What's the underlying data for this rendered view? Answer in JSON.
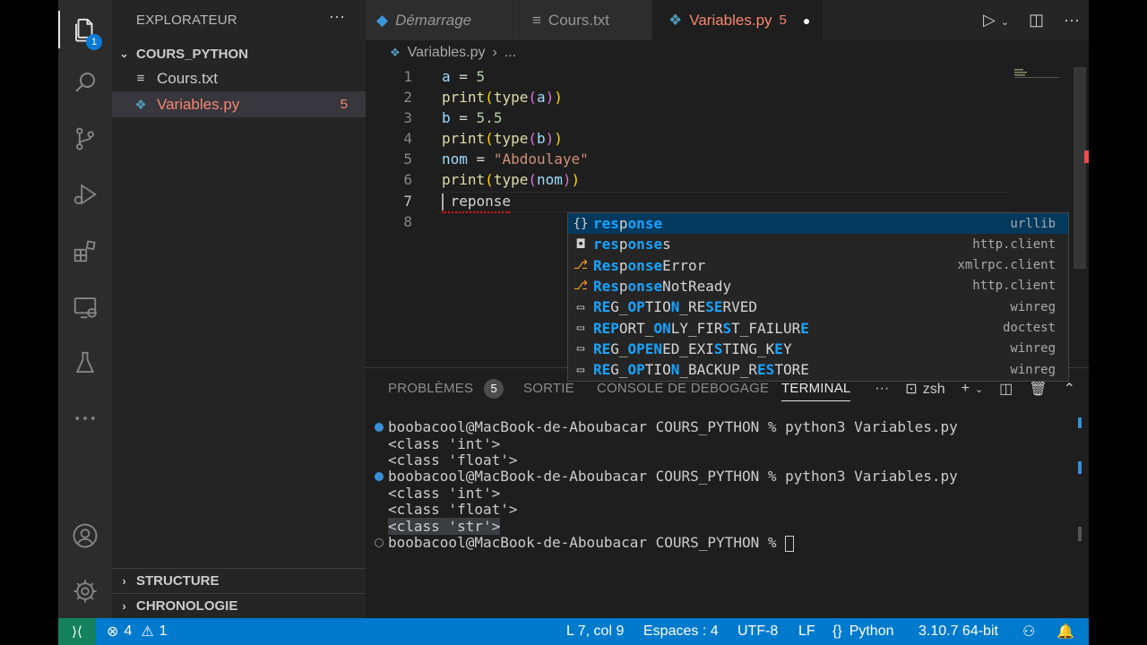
{
  "activity_bar": {
    "explorer_badge": "1"
  },
  "sidebar": {
    "title": "EXPLORATEUR",
    "more": "···",
    "folder": "COURS_PYTHON",
    "files": [
      {
        "name": "Cours.txt",
        "count": ""
      },
      {
        "name": "Variables.py",
        "count": "5"
      }
    ],
    "bottom_sections": [
      "STRUCTURE",
      "CHRONOLOGIE"
    ]
  },
  "tabs": [
    {
      "label": "Démarrage"
    },
    {
      "label": "Cours.txt"
    },
    {
      "label": "Variables.py",
      "count": "5"
    }
  ],
  "breadcrumb": {
    "file": "Variables.py",
    "rest": "..."
  },
  "editor": {
    "line_numbers": [
      "1",
      "2",
      "3",
      "4",
      "5",
      "6",
      "7",
      "8"
    ],
    "lines": {
      "l1": {
        "a": "a",
        "eq": " = ",
        "n": "5"
      },
      "l2": {
        "fn": "print",
        "o": "(",
        "t": "type",
        "o2": "(",
        "v": "a",
        "c2": ")",
        "c": ")"
      },
      "l3": {
        "a": "b",
        "eq": " = ",
        "n": "5.5"
      },
      "l4": {
        "fn": "print",
        "o": "(",
        "t": "type",
        "o2": "(",
        "v": "b",
        "c2": ")",
        "c": ")"
      },
      "l5": {
        "a": "nom",
        "eq": " = ",
        "s": "\"Abdoulaye\""
      },
      "l6": {
        "fn": "print",
        "o": "(",
        "t": "type",
        "o2": "(",
        "v": "nom",
        "c2": ")",
        "c": ")"
      },
      "l7": {
        "text": " reponse"
      }
    }
  },
  "suggestions": [
    {
      "icon": "{}",
      "parts": [
        [
          "hl",
          "res"
        ],
        [
          "",
          "p"
        ],
        [
          "hl",
          "onse"
        ]
      ],
      "detail": "urllib"
    },
    {
      "icon": "◘",
      "parts": [
        [
          "hl",
          "res"
        ],
        [
          "",
          "p"
        ],
        [
          "hl",
          "onse"
        ],
        [
          "",
          "s"
        ]
      ],
      "detail": "http.client"
    },
    {
      "icon": "⎇",
      "parts": [
        [
          "hl",
          "Res"
        ],
        [
          "",
          "p"
        ],
        [
          "hl",
          "onse"
        ],
        [
          "",
          "Error"
        ]
      ],
      "detail": "xmlrpc.client"
    },
    {
      "icon": "⎇",
      "parts": [
        [
          "hl",
          "Res"
        ],
        [
          "",
          "p"
        ],
        [
          "hl",
          "onse"
        ],
        [
          "",
          "NotReady"
        ]
      ],
      "detail": "http.client"
    },
    {
      "icon": "▭",
      "parts": [
        [
          "hl",
          "RE"
        ],
        [
          "",
          "G_"
        ],
        [
          "hl",
          "OP"
        ],
        [
          "",
          "TIO"
        ],
        [
          "hl",
          "N"
        ],
        [
          "",
          "_RE"
        ],
        [
          "hl",
          "SE"
        ],
        [
          "",
          "RVED"
        ]
      ],
      "detail": "winreg"
    },
    {
      "icon": "▭",
      "parts": [
        [
          "hl",
          "REP"
        ],
        [
          "",
          "ORT_"
        ],
        [
          "hl",
          "ON"
        ],
        [
          "",
          "LY_FIR"
        ],
        [
          "hl",
          "S"
        ],
        [
          "",
          "T_FAILUR"
        ],
        [
          "hl",
          "E"
        ]
      ],
      "detail": "doctest"
    },
    {
      "icon": "▭",
      "parts": [
        [
          "hl",
          "RE"
        ],
        [
          "",
          "G_"
        ],
        [
          "hl",
          "OPEN"
        ],
        [
          "",
          "ED_EXI"
        ],
        [
          "hl",
          "S"
        ],
        [
          "",
          "TING_K"
        ],
        [
          "hl",
          "E"
        ],
        [
          "",
          "Y"
        ]
      ],
      "detail": "winreg"
    },
    {
      "icon": "▭",
      "parts": [
        [
          "hl",
          "RE"
        ],
        [
          "",
          "G_"
        ],
        [
          "hl",
          "OP"
        ],
        [
          "",
          "TIO"
        ],
        [
          "hl",
          "N"
        ],
        [
          "",
          "_BACKUP_R"
        ],
        [
          "hl",
          "ES"
        ],
        [
          "",
          "TORE"
        ]
      ],
      "detail": "winreg"
    }
  ],
  "panel": {
    "tabs": [
      "PROBLÈMES",
      "SORTIE",
      "CONSOLE DE DEBOGAGE",
      "TERMINAL"
    ],
    "problems_count": "5",
    "shell": "zsh",
    "terminal_lines": [
      "boobacool@MacBook-de-Aboubacar COURS_PYTHON % python3 Variables.py",
      "<class 'int'>",
      "<class 'float'>",
      "boobacool@MacBook-de-Aboubacar COURS_PYTHON % python3 Variables.py",
      "<class 'int'>",
      "<class 'float'>",
      "<class 'str'>",
      "boobacool@MacBook-de-Aboubacar COURS_PYTHON % "
    ]
  },
  "status_bar": {
    "errors": "4",
    "warnings": "1",
    "position": "L 7, col 9",
    "spaces": "Espaces : 4",
    "encoding": "UTF-8",
    "eol": "LF",
    "language": "Python",
    "interpreter": "3.10.7 64-bit"
  },
  "colors": {
    "accent": "#007acc",
    "remote": "#16825d",
    "error_tab": "#f48771",
    "match_highlight": "#18a3ff"
  }
}
